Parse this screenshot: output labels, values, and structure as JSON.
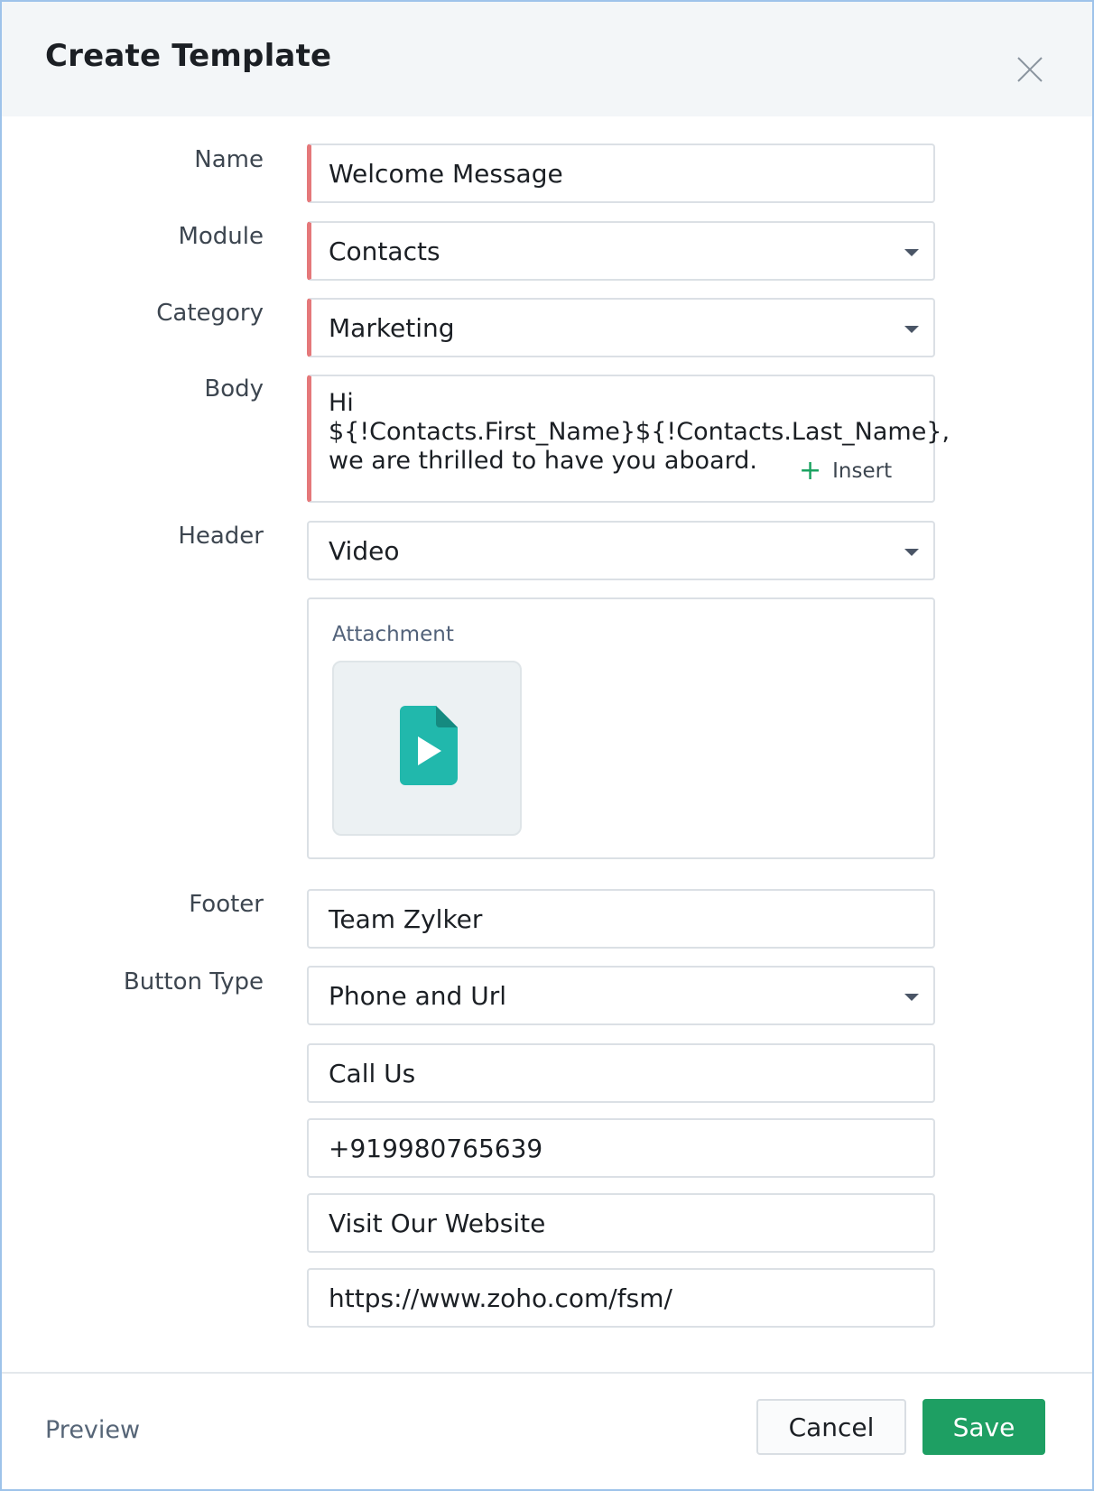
{
  "dialog": {
    "title": "Create Template"
  },
  "form": {
    "name_label": "Name",
    "name_value": "Welcome Message",
    "module_label": "Module",
    "module_value": "Contacts",
    "category_label": "Category",
    "category_value": "Marketing",
    "body_label": "Body",
    "body_lines": [
      "Hi",
      "${!Contacts.First_Name}${!Contacts.Last_Name},",
      "we are thrilled to have you aboard."
    ],
    "insert_label": "Insert",
    "header_label": "Header",
    "header_value": "Video",
    "attachment_label": "Attachment",
    "footer_label": "Footer",
    "footer_value": "Team Zylker",
    "button_type_label": "Button Type",
    "button_type_value": "Phone and Url",
    "call_button_text": "Call Us",
    "phone_number": "+919980765639",
    "url_button_text": "Visit Our Website",
    "url": "https://www.zoho.com/fsm/"
  },
  "actions": {
    "preview": "Preview",
    "cancel": "Cancel",
    "save": "Save"
  },
  "icons": {
    "close": "close-icon",
    "dropdown": "chevron-down-icon",
    "insert": "plus-icon",
    "video_file": "video-file-icon"
  },
  "colors": {
    "required_marker": "#e5787a",
    "save_button": "#1e9f63",
    "video_icon": "#21b8ac",
    "insert_plus": "#1aa260"
  }
}
